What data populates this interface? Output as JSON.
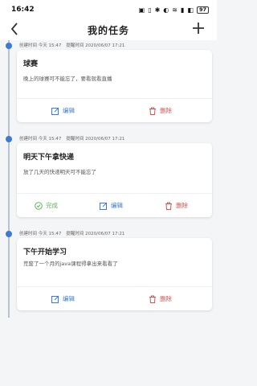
{
  "status": {
    "time": "16:42",
    "icons": [
      "nfc-icon",
      "vibrate-icon",
      "bluetooth-icon",
      "silent-icon",
      "wifi-icon",
      "signal-icon",
      "hd-icon"
    ],
    "battery": "97"
  },
  "header": {
    "title": "我的任务",
    "back_icon": "back-chevron-icon",
    "add_icon": "plus-icon"
  },
  "colors": {
    "accent": "#3a7bd5",
    "delete": "#d9534f",
    "done": "#5cb85c",
    "timeline": "#b9c2cf"
  },
  "tasks": [
    {
      "created_label": "创建时间 今天 15:47",
      "remind_label": "提醒时间 2020/06/07 17:21",
      "title": "球赛",
      "body": "晚上的球赛可不能忘了，要看就看直播",
      "actions": {
        "edit": "编辑",
        "delete": "删除"
      }
    },
    {
      "created_label": "创建时间 今天 15:47",
      "remind_label": "提醒时间 2020/06/07 17:21",
      "title": "明天下午拿快递",
      "body": "放了几天的快递明天可不能忘了",
      "actions": {
        "done": "完成",
        "edit": "编辑",
        "delete": "删除"
      }
    },
    {
      "created_label": "创建时间 今天 15:47",
      "remind_label": "提醒时间 2020/06/07 17:21",
      "title": "下午开始学习",
      "body": "荒废了一个月的java课程得拿出来看看了",
      "actions": {
        "edit": "编辑",
        "delete": "删除"
      }
    }
  ]
}
